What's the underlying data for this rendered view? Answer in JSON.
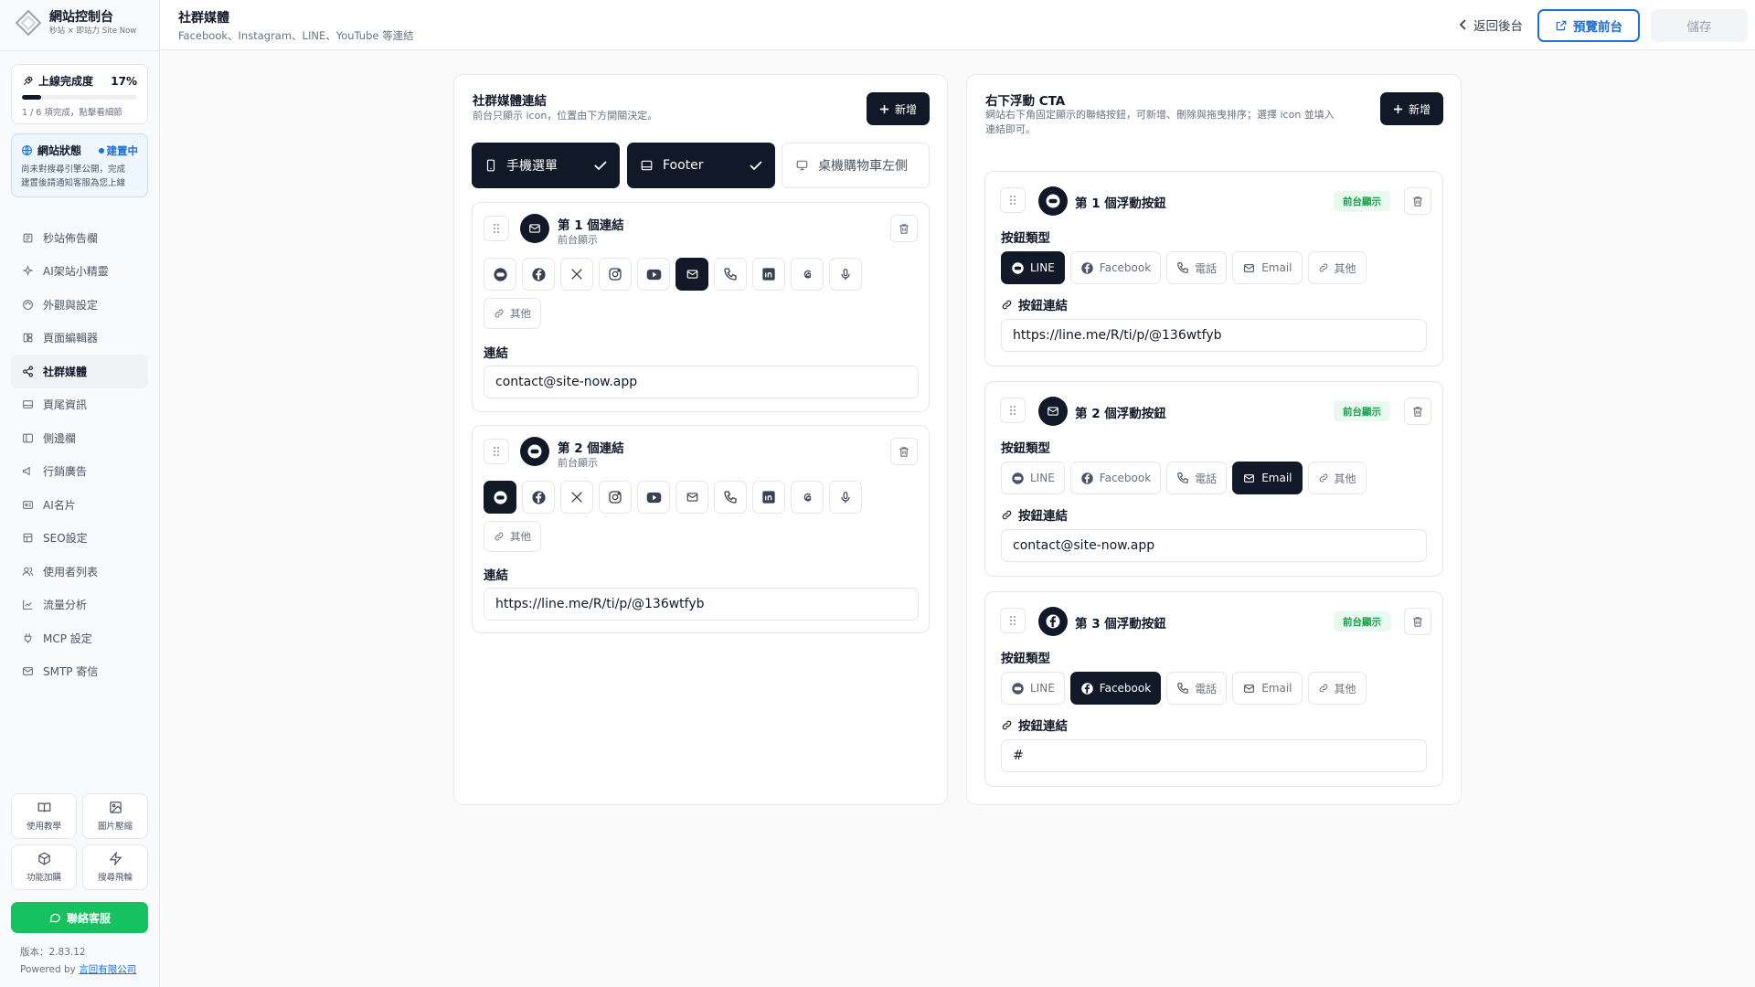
{
  "sidebar": {
    "logo": {
      "title": "網站控制台",
      "subtitle": "秒站 × 即站力 Site Now"
    },
    "progress": {
      "label": "上線完成度",
      "percent_label": "17%",
      "fraction": 0.17,
      "note": "1 / 6 項完成，點擊看細節"
    },
    "status": {
      "label": "網站狀態",
      "badge": "建置中",
      "note_line1": "尚未對搜尋引擎公開，完成",
      "note_line2": "建置後請通知客服為您上線"
    },
    "nav": [
      {
        "label": "秒站佈告欄",
        "icon": "newspaper-icon"
      },
      {
        "label": "AI架站小精靈",
        "icon": "sparkles-icon"
      },
      {
        "label": "外觀與設定",
        "icon": "palette-icon"
      },
      {
        "label": "頁面編輯器",
        "icon": "layout-icon"
      },
      {
        "label": "社群媒體",
        "icon": "share-icon"
      },
      {
        "label": "頁尾資訊",
        "icon": "footer-icon"
      },
      {
        "label": "側邊欄",
        "icon": "sidebar-icon"
      },
      {
        "label": "行銷廣告",
        "icon": "megaphone-icon"
      },
      {
        "label": "AI名片",
        "icon": "id-card-icon"
      },
      {
        "label": "SEO設定",
        "icon": "seo-icon"
      },
      {
        "label": "使用者列表",
        "icon": "users-icon"
      },
      {
        "label": "流量分析",
        "icon": "chart-icon"
      },
      {
        "label": "MCP 設定",
        "icon": "plug-icon"
      },
      {
        "label": "SMTP 寄信",
        "icon": "mail-icon"
      }
    ],
    "tiles": [
      {
        "label": "使用教學",
        "icon": "book-icon"
      },
      {
        "label": "圖片壓縮",
        "icon": "image-icon"
      },
      {
        "label": "功能加購",
        "icon": "package-icon"
      },
      {
        "label": "搜尋飛輪",
        "icon": "zap-icon"
      }
    ],
    "contact_label": "聯絡客服",
    "version": "版本：2.83.12",
    "powered_prefix": "Powered by ",
    "powered_company": "言回有限公司"
  },
  "header": {
    "title": "社群媒體",
    "subtitle": "Facebook、Instagram、LINE、YouTube 等連結",
    "back_label": "返回後台",
    "preview_label": "預覽前台",
    "save_label": "儲存"
  },
  "social": {
    "title": "社群媒體連結",
    "desc": "前台只顯示 icon，位置由下方開關決定。",
    "add_label": "新增",
    "toggles": [
      {
        "label": "手機選單",
        "on": true,
        "icon": "phone-icon"
      },
      {
        "label": "Footer",
        "on": true,
        "icon": "footer-icon"
      },
      {
        "label": "桌機購物車左側",
        "on": false,
        "icon": "monitor-icon"
      }
    ],
    "icon_types": [
      "line-icon",
      "facebook-icon",
      "x-icon",
      "instagram-icon",
      "youtube-icon",
      "email-icon",
      "phone-icon",
      "linkedin-icon",
      "threads-icon",
      "microphone-icon"
    ],
    "other_label": "其他",
    "link_label": "連結",
    "links": [
      {
        "title": "第 1 個連結",
        "visibility": "前台顯示",
        "selected": "email-icon",
        "value": "contact@site-now.app"
      },
      {
        "title": "第 2 個連結",
        "visibility": "前台顯示",
        "selected": "line-icon",
        "value": "https://line.me/R/ti/p/@136wtfyb"
      }
    ]
  },
  "cta": {
    "title": "右下浮動 CTA",
    "desc_line1": "網站右下角固定顯示的聯絡按鈕，可新增、刪除與拖曳排序；選擇 icon 並填入",
    "desc_line2": "連結即可。",
    "add_label": "新增",
    "type_label": "按鈕類型",
    "link_label": "按鈕連結",
    "types": [
      {
        "label": "LINE",
        "icon": "line-icon"
      },
      {
        "label": "Facebook",
        "icon": "facebook-icon"
      },
      {
        "label": "電話",
        "icon": "phone-icon"
      },
      {
        "label": "Email",
        "icon": "email-icon"
      },
      {
        "label": "其他",
        "icon": "link-icon"
      }
    ],
    "buttons": [
      {
        "title": "第 1 個浮動按鈕",
        "badge": "前台顯示",
        "selected": 0,
        "value": "https://line.me/R/ti/p/@136wtfyb"
      },
      {
        "title": "第 2 個浮動按鈕",
        "badge": "前台顯示",
        "selected": 3,
        "value": "contact@site-now.app"
      },
      {
        "title": "第 3 個浮動按鈕",
        "badge": "前台顯示",
        "selected": 1,
        "value": "#"
      }
    ]
  },
  "colors": {
    "accent": "#1d6fe0",
    "primary": "#111827",
    "success": "#16c25f",
    "badge_text": "#15a34a"
  }
}
